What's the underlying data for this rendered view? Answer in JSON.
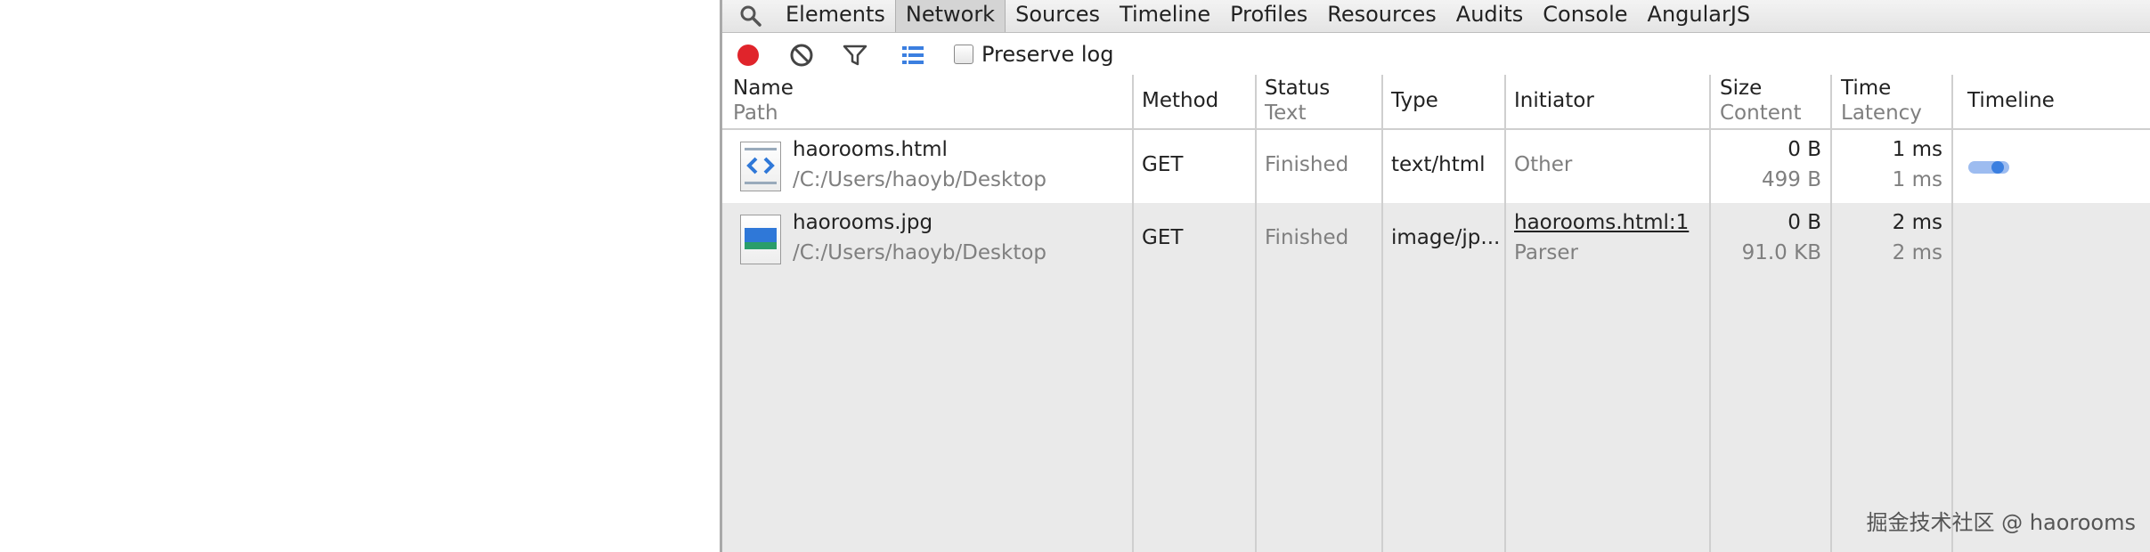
{
  "tabs": [
    "Elements",
    "Network",
    "Sources",
    "Timeline",
    "Profiles",
    "Resources",
    "Audits",
    "Console",
    "AngularJS"
  ],
  "network_toolbar": {
    "record_icon": "record-icon",
    "clear_icon": "clear-icon",
    "filter_icon": "filter-icon",
    "view_icon": "large-rows-icon",
    "preserve_log_label": "Preserve log",
    "preserve_log_checked": false
  },
  "columns": {
    "name": {
      "main": "Name",
      "sub": "Path"
    },
    "method": "Method",
    "status": {
      "main": "Status",
      "sub": "Text"
    },
    "type": "Type",
    "initiator": "Initiator",
    "size": {
      "main": "Size",
      "sub": "Content"
    },
    "time": {
      "main": "Time",
      "sub": "Latency"
    },
    "timeline": "Timeline"
  },
  "rows": [
    {
      "icon": "html-file-icon",
      "name": "haorooms.html",
      "path": "/C:/Users/haoyb/Desktop",
      "method": "GET",
      "status": "Finished",
      "type": "text/html",
      "initiator": "Other",
      "initiator_sub": "",
      "size": "0 B",
      "content": "499 B",
      "time": "1 ms",
      "latency": "1 ms"
    },
    {
      "icon": "image-file-icon",
      "name": "haorooms.jpg",
      "path": "/C:/Users/haoyb/Desktop",
      "method": "GET",
      "status": "Finished",
      "type": "image/jp...",
      "initiator": "haorooms.html:1",
      "initiator_sub": "Parser",
      "size": "0 B",
      "content": "91.0 KB",
      "time": "2 ms",
      "latency": "2 ms"
    }
  ],
  "watermark": "掘金技术社区 @ haorooms",
  "colors": {
    "record": "#e0242b",
    "accent_blue": "#3b7fe0"
  }
}
